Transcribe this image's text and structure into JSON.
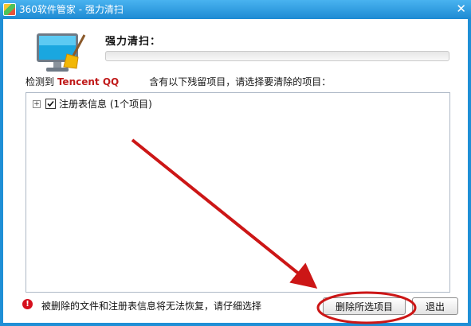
{
  "window": {
    "title": "360软件管家 - 强力清扫",
    "close_symbol": "✕",
    "app_icon": "360-logo-icon"
  },
  "header": {
    "heading": "强力清扫：",
    "progress_fraction": 0.0
  },
  "prompt": {
    "prefix": "检测到",
    "software_name": "Tencent QQ",
    "suffix": "含有以下残留项目，请选择要清除的项目："
  },
  "tree": {
    "items": [
      {
        "expander": "+",
        "checked": true,
        "label": "注册表信息 (1个项目)"
      }
    ]
  },
  "footer": {
    "warning_icon": "exclamation-icon",
    "warning_symbol": "!",
    "warning_text": "被删除的文件和注册表信息将无法恢复，请仔细选择",
    "delete_button": "删除所选项目",
    "exit_button": "退出"
  },
  "colors": {
    "titlebar": "#1d8ad3",
    "software_name": "#c01a1a",
    "annotation": "#cc1616"
  }
}
